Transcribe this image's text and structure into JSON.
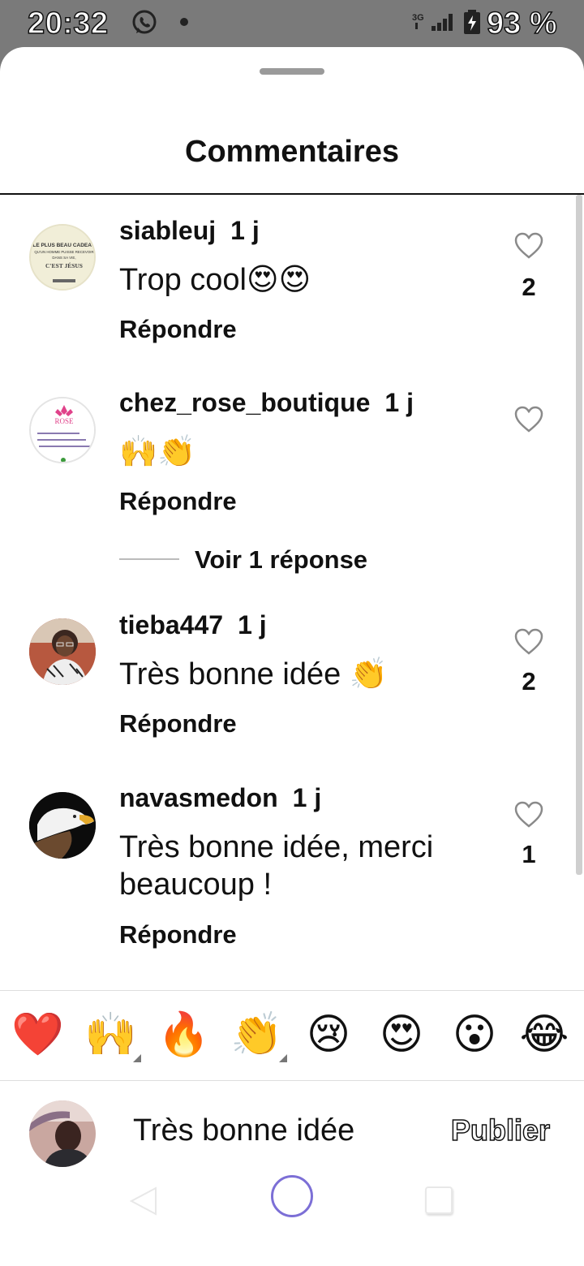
{
  "status_bar": {
    "time": "20:32",
    "battery": "93 %",
    "network": "3G",
    "icons": [
      "whatsapp-icon",
      "notification-dot-icon",
      "signal-icon",
      "battery-charging-icon"
    ]
  },
  "header": {
    "title": "Commentaires"
  },
  "comments": [
    {
      "username": "siableuj",
      "age": "1 j",
      "text": "Trop cool😍😍",
      "reply_label": "Répondre",
      "likes": "2"
    },
    {
      "username": "chez_rose_boutique",
      "age": "1 j",
      "text": "🙌👏",
      "reply_label": "Répondre",
      "likes": ""
    },
    {
      "username": "tieba447",
      "age": "1 j",
      "text": "Très bonne idée 👏",
      "reply_label": "Répondre",
      "likes": "2"
    },
    {
      "username": "navasmedon",
      "age": "1 j",
      "text": "Très bonne idée, merci beaucoup !",
      "reply_label": "Répondre",
      "likes": "1"
    }
  ],
  "view_replies": "Voir 1 réponse",
  "avatar_texts": {
    "siableuj": [
      "LE PLUS BEAU CADEAU",
      "QU'UN HOMME PUISSE RECEVOIR",
      "DANS SA VIE,",
      "C'EST JÉSUS"
    ],
    "chez_rose_boutique": [
      "ROSE"
    ]
  },
  "quick_reactions": [
    "❤️",
    "🙌",
    "🔥",
    "👏",
    "😢",
    "😍",
    "😮",
    "😂"
  ],
  "composer": {
    "value": "Très bonne idée",
    "publish_label": "Publier"
  },
  "colors": {
    "status_bar_bg": "#7a7a7a",
    "sheet_bg": "#ffffff",
    "text": "#111111",
    "home_button": "#7c6fd6"
  }
}
